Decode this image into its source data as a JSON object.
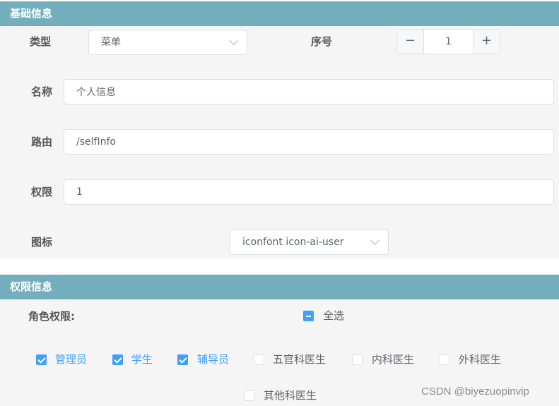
{
  "basic_section": {
    "title": "基础信息",
    "type_label": "类型",
    "type_value": "菜单",
    "order_label": "序号",
    "order_value": "1",
    "order_minus": "−",
    "order_plus": "+",
    "name_label": "名称",
    "name_value": "个人信息",
    "route_label": "路由",
    "route_value": "/selfInfo",
    "perm_label": "权限",
    "perm_value": "1",
    "icon_label": "图标",
    "icon_value": "iconfont icon-ai-user"
  },
  "perm_section": {
    "title": "权限信息",
    "role_label": "角色权限:",
    "select_all": {
      "label": "全选",
      "state": "indeterminate"
    },
    "roles": [
      {
        "label": "管理员",
        "checked": true
      },
      {
        "label": "学生",
        "checked": true
      },
      {
        "label": "辅导员",
        "checked": true
      },
      {
        "label": "五官科医生",
        "checked": false
      },
      {
        "label": "内科医生",
        "checked": false
      },
      {
        "label": "外科医生",
        "checked": false
      },
      {
        "label": "其他科医生",
        "checked": false
      }
    ]
  },
  "watermark": "CSDN @biyezuopinvip",
  "colors": {
    "header_bg": "#72aebc",
    "accent": "#409eff",
    "body_bg": "#f5f5f5"
  }
}
